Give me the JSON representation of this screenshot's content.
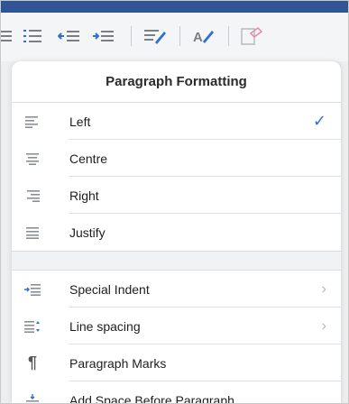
{
  "colors": {
    "brand_bar": "#2f5597",
    "check": "#2f6fd6",
    "icon_blue": "#2f6fd6",
    "icon_gray": "#7a7f86"
  },
  "toolbar": {
    "icons": [
      "bullets-icon",
      "numbered-list-icon",
      "decrease-indent-icon",
      "increase-indent-icon",
      "paragraph-formatting-icon",
      "styles-icon",
      "clear-formatting-icon"
    ]
  },
  "popover": {
    "title": "Paragraph Formatting",
    "alignment": [
      {
        "label": "Left",
        "icon": "align-left-icon",
        "selected": true
      },
      {
        "label": "Centre",
        "icon": "align-center-icon",
        "selected": false
      },
      {
        "label": "Right",
        "icon": "align-right-icon",
        "selected": false
      },
      {
        "label": "Justify",
        "icon": "align-justify-icon",
        "selected": false
      }
    ],
    "options": [
      {
        "label": "Special Indent",
        "icon": "special-indent-icon",
        "has_chevron": true
      },
      {
        "label": "Line spacing",
        "icon": "line-spacing-icon",
        "has_chevron": true
      },
      {
        "label": "Paragraph Marks",
        "icon": "pilcrow-icon",
        "has_chevron": false
      },
      {
        "label": "Add Space Before Paragraph",
        "icon": "space-before-icon",
        "has_chevron": false
      }
    ],
    "check_glyph": "✓",
    "chevron_glyph": "›",
    "pilcrow_glyph": "¶"
  }
}
